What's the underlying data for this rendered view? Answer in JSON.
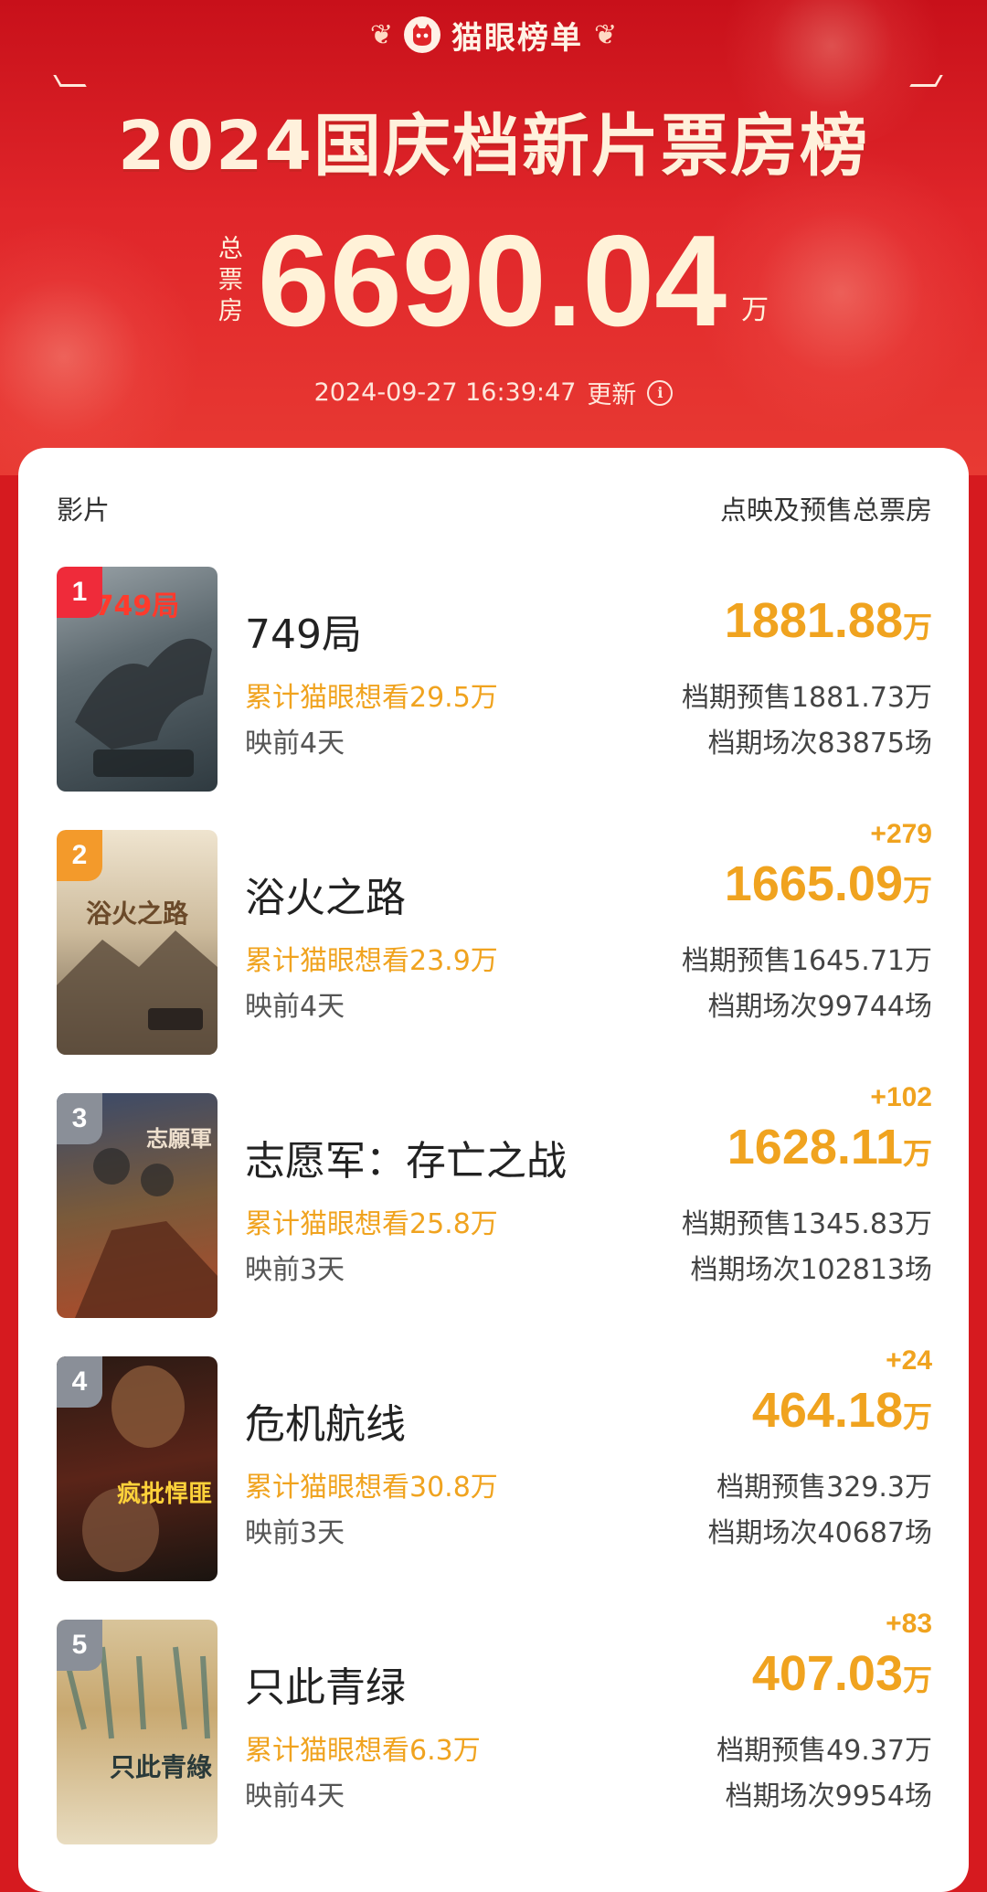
{
  "brand": {
    "name": "猫眼榜单",
    "logo_icon": "cat-face-icon"
  },
  "header": {
    "title": "2024国庆档新片票房榜",
    "total_label": [
      "总",
      "票",
      "房"
    ],
    "total_value": "6690.04",
    "total_unit": "万",
    "update_time": "2024-09-27  16:39:47",
    "update_label": "更新",
    "info_icon": "info-icon"
  },
  "table": {
    "col_movie": "影片",
    "col_gross": "点映及预售总票房"
  },
  "movies": [
    {
      "rank": "1",
      "name": "749局",
      "delta": "",
      "gross": "1881.88",
      "unit": "万",
      "want": "累计猫眼想看29.5万",
      "days": "映前4天",
      "presale": "档期预售1881.73万",
      "screenings": "档期场次83875场",
      "poster_text": "749局",
      "rank_color": "#ef2b3a"
    },
    {
      "rank": "2",
      "name": "浴火之路",
      "delta": "+279",
      "gross": "1665.09",
      "unit": "万",
      "want": "累计猫眼想看23.9万",
      "days": "映前4天",
      "presale": "档期预售1645.71万",
      "screenings": "档期场次99744场",
      "poster_text": "浴火之路",
      "rank_color": "#f39a2b"
    },
    {
      "rank": "3",
      "name": "志愿军：存亡之战",
      "delta": "+102",
      "gross": "1628.11",
      "unit": "万",
      "want": "累计猫眼想看25.8万",
      "days": "映前3天",
      "presale": "档期预售1345.83万",
      "screenings": "档期场次102813场",
      "poster_text": "志願軍",
      "rank_color": "#8a8f98"
    },
    {
      "rank": "4",
      "name": "危机航线",
      "delta": "+24",
      "gross": "464.18",
      "unit": "万",
      "want": "累计猫眼想看30.8万",
      "days": "映前3天",
      "presale": "档期预售329.3万",
      "screenings": "档期场次40687场",
      "poster_text": "疯批悍匪",
      "rank_color": "#8a8f98"
    },
    {
      "rank": "5",
      "name": "只此青绿",
      "delta": "+83",
      "gross": "407.03",
      "unit": "万",
      "want": "累计猫眼想看6.3万",
      "days": "映前4天",
      "presale": "档期预售49.37万",
      "screenings": "档期场次9954场",
      "poster_text": "只此青綠",
      "rank_color": "#8a8f98"
    }
  ]
}
